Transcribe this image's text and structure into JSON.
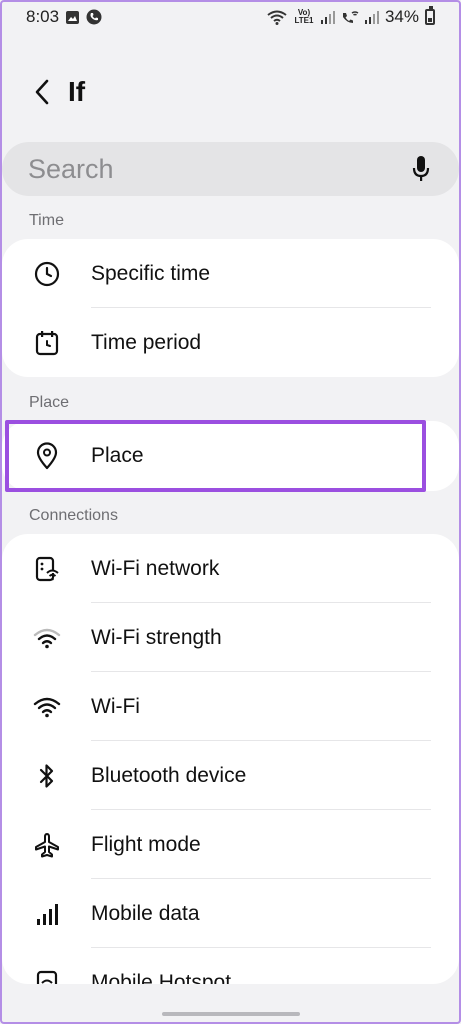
{
  "status_bar": {
    "time": "8:03",
    "battery": "34%",
    "network_label": "Vo) LTE1"
  },
  "header": {
    "title": "If"
  },
  "search": {
    "placeholder": "Search"
  },
  "sections": {
    "time": {
      "label": "Time",
      "items": [
        {
          "label": "Specific time",
          "icon": "clock-icon"
        },
        {
          "label": "Time period",
          "icon": "calendar-icon"
        }
      ]
    },
    "place": {
      "label": "Place",
      "items": [
        {
          "label": "Place",
          "icon": "location-pin-icon"
        }
      ]
    },
    "connections": {
      "label": "Connections",
      "items": [
        {
          "label": "Wi-Fi network",
          "icon": "wifi-network-icon"
        },
        {
          "label": "Wi-Fi strength",
          "icon": "wifi-strength-icon"
        },
        {
          "label": "Wi-Fi",
          "icon": "wifi-icon"
        },
        {
          "label": "Bluetooth device",
          "icon": "bluetooth-icon"
        },
        {
          "label": "Flight mode",
          "icon": "airplane-icon"
        },
        {
          "label": "Mobile data",
          "icon": "signal-bars-icon"
        },
        {
          "label": "Mobile Hotspot",
          "icon": "hotspot-icon"
        }
      ]
    }
  },
  "colors": {
    "highlight": "#9b4fe0",
    "background": "#f2f2f4",
    "card": "#ffffff"
  }
}
